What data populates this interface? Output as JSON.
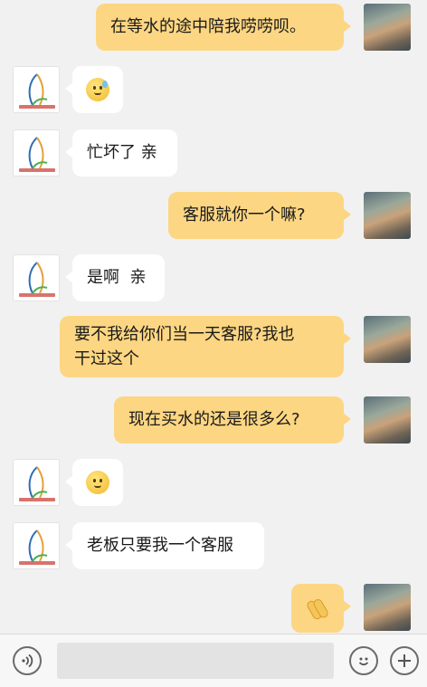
{
  "messages": [
    {
      "side": "me",
      "type": "text",
      "text": "在等水的途中陪我唠唠呗。"
    },
    {
      "side": "other",
      "type": "emoji",
      "icon": "sweat-smile-emoji-icon"
    },
    {
      "side": "other",
      "type": "text",
      "text": "忙坏了 亲"
    },
    {
      "side": "me",
      "type": "text",
      "text": "客服就你一个嘛?"
    },
    {
      "side": "other",
      "type": "text",
      "text": "是啊  亲"
    },
    {
      "side": "me",
      "type": "text",
      "text_line1": "要不我给你们当一天客服?我也",
      "text_line2": "干过这个"
    },
    {
      "side": "me",
      "type": "text",
      "text": "现在买水的还是很多么?"
    },
    {
      "side": "other",
      "type": "emoji",
      "icon": "smile-emoji-icon"
    },
    {
      "side": "other",
      "type": "text",
      "text": "老板只要我一个客服"
    },
    {
      "side": "me",
      "type": "emoji",
      "icon": "clapping-hands-icon"
    }
  ],
  "input_bar": {
    "voice_icon": "voice-icon",
    "placeholder": "",
    "emoji_icon": "emoji-icon",
    "add_icon": "add-icon"
  },
  "colors": {
    "background": "#f1f1f1",
    "my_bubble": "#fcd682",
    "other_bubble": "#ffffff"
  }
}
